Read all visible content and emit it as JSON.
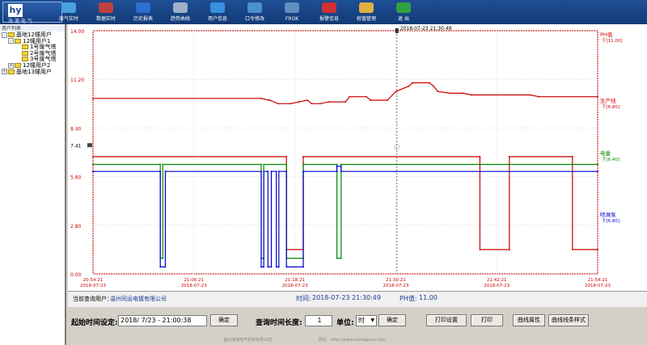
{
  "app": {
    "logo_text": "hy",
    "logo_subtitle": "海 港 电 气"
  },
  "toolbar": [
    {
      "label": "废气实时",
      "icon": "gauge-icon",
      "color": "#4aa0e0"
    },
    {
      "label": "数据实时",
      "icon": "monitor-icon",
      "color": "#c04040"
    },
    {
      "label": "历史报表",
      "icon": "chart-icon",
      "color": "#2b6fd0"
    },
    {
      "label": "趋势曲线",
      "icon": "curve-icon",
      "color": "#9db0c8"
    },
    {
      "label": "用户信息",
      "icon": "globe-icon",
      "color": "#3a8fe0"
    },
    {
      "label": "口令修改",
      "icon": "lock-icon",
      "color": "#4a90d0"
    },
    {
      "label": "FROK",
      "icon": "network-icon",
      "color": "#6090c0"
    },
    {
      "label": "报警信息",
      "icon": "alarm-icon",
      "color": "#d03030"
    },
    {
      "label": "权值管理",
      "icon": "key-icon",
      "color": "#e0b040"
    },
    {
      "label": "退  出",
      "icon": "exit-icon",
      "color": "#30a040"
    }
  ],
  "sidebar": {
    "title": "用户列表",
    "tree": [
      {
        "label": "基地12幢用户",
        "level": 0,
        "toggle": "-",
        "folder": true
      },
      {
        "label": "12幢用户1",
        "level": 1,
        "toggle": "-",
        "folder": true
      },
      {
        "label": "1号废气塔",
        "level": 2,
        "toggle": "",
        "folder": true
      },
      {
        "label": "2号废气塔",
        "level": 2,
        "toggle": "",
        "folder": true
      },
      {
        "label": "3号废气塔",
        "level": 2,
        "toggle": "",
        "folder": true
      },
      {
        "label": "12幢用户2",
        "level": 1,
        "toggle": "+",
        "folder": true
      },
      {
        "label": "基地13幢用户",
        "level": 0,
        "toggle": "+",
        "folder": true
      }
    ]
  },
  "chart_data": {
    "type": "line",
    "ylim": [
      0,
      14
    ],
    "y_ticks": [
      "0.00",
      "2.80",
      "5.60",
      "8.40",
      "11.20",
      "14.00"
    ],
    "y_tick_values": [
      0,
      2.8,
      5.6,
      8.4,
      11.2,
      14
    ],
    "extra_ytick": {
      "label": "7.41",
      "value": 7.41
    },
    "x_ticks": [
      {
        "time": "20:54:21",
        "date": "2018-07-23"
      },
      {
        "time": "21:06:21",
        "date": "2018-07-23"
      },
      {
        "time": "21:18:21",
        "date": "2018-07-23"
      },
      {
        "time": "21:30:21",
        "date": "2018-07-23"
      },
      {
        "time": "21:42:21",
        "date": "2018-07-23"
      },
      {
        "time": "21:54:21",
        "date": "2018-07-23"
      }
    ],
    "xlim_minutes": [
      0,
      60
    ],
    "cursor": {
      "minute": 36.13,
      "label": "2018-07-23  21:30:49"
    },
    "series": [
      {
        "name": "PH值",
        "color": "#cc0000",
        "values_text": "下[11.00]",
        "points": [
          [
            0,
            10.1
          ],
          [
            20,
            10.1
          ],
          [
            21,
            10
          ],
          [
            22,
            9.8
          ],
          [
            23.5,
            9.8
          ],
          [
            24.5,
            9.9
          ],
          [
            25.5,
            10
          ],
          [
            26,
            9.8
          ],
          [
            27,
            9.8
          ],
          [
            28,
            9.9
          ],
          [
            30,
            9.9
          ],
          [
            30.5,
            10.2
          ],
          [
            32.5,
            10.2
          ],
          [
            33,
            10
          ],
          [
            35,
            10
          ],
          [
            36,
            10.5
          ],
          [
            37.5,
            10.8
          ],
          [
            38,
            11
          ],
          [
            40,
            11
          ],
          [
            40.5,
            10.8
          ],
          [
            41,
            10.5
          ],
          [
            42.5,
            10.4
          ],
          [
            44,
            10.4
          ],
          [
            45,
            10.3
          ],
          [
            52,
            10.3
          ],
          [
            53,
            10.2
          ],
          [
            60,
            10.2
          ]
        ]
      },
      {
        "name": "生产线",
        "color": "#cc0000",
        "values_text": "下[6.80]",
        "points": [
          [
            0,
            6.75
          ],
          [
            23,
            6.75
          ],
          [
            23,
            1.4
          ],
          [
            25,
            1.4
          ],
          [
            25,
            6.75
          ],
          [
            46,
            6.75
          ],
          [
            46,
            1.4
          ],
          [
            49.5,
            1.4
          ],
          [
            49.5,
            6.75
          ],
          [
            57,
            6.75
          ],
          [
            57,
            1.4
          ],
          [
            60,
            1.4
          ]
        ]
      },
      {
        "name": "电量",
        "color": "#008800",
        "values_text": "下[6.40]",
        "points": [
          [
            0,
            6.3
          ],
          [
            8,
            6.3
          ],
          [
            8,
            0.9
          ],
          [
            8.3,
            0.9
          ],
          [
            8.3,
            6.3
          ],
          [
            20,
            6.3
          ],
          [
            20,
            0.9
          ],
          [
            20.3,
            0.9
          ],
          [
            20.3,
            6.3
          ],
          [
            23,
            6.3
          ],
          [
            23,
            0.9
          ],
          [
            25,
            0.9
          ],
          [
            25,
            6.3
          ],
          [
            29,
            6.3
          ],
          [
            29,
            0.9
          ],
          [
            29.5,
            0.9
          ],
          [
            29.5,
            6.3
          ],
          [
            60,
            6.3
          ]
        ]
      },
      {
        "name": "喷淋泵",
        "color": "#0000cc",
        "values_text": "下[6.80]",
        "points": [
          [
            0,
            5.9
          ],
          [
            8,
            5.9
          ],
          [
            8,
            0.4
          ],
          [
            8.6,
            0.4
          ],
          [
            8.6,
            5.9
          ],
          [
            20,
            5.9
          ],
          [
            20,
            0.4
          ],
          [
            20.3,
            0.4
          ],
          [
            20.3,
            5.9
          ],
          [
            20.8,
            5.9
          ],
          [
            20.8,
            0.4
          ],
          [
            21.2,
            0.4
          ],
          [
            21.2,
            5.9
          ],
          [
            21.8,
            5.9
          ],
          [
            21.8,
            0.4
          ],
          [
            22.1,
            0.4
          ],
          [
            22.1,
            5.9
          ],
          [
            23,
            5.9
          ],
          [
            23,
            0.4
          ],
          [
            25,
            0.4
          ],
          [
            25,
            5.9
          ],
          [
            29,
            5.9
          ],
          [
            29,
            6.2
          ],
          [
            29.5,
            6.2
          ],
          [
            29.5,
            5.9
          ],
          [
            60,
            5.9
          ]
        ]
      }
    ]
  },
  "infobar": {
    "query_user_label": "当前查询用户：",
    "query_user_value": "温州同运电镀有限公司",
    "time_label": "时间:",
    "time_value": "2018-07-23 21:30:49",
    "ph_label": "PH值:",
    "ph_value": "11.00"
  },
  "controls": {
    "start_time_label": "起始时间设定:",
    "start_time_value": "2018/ 7/23 - 21:00:38",
    "confirm1": "确定",
    "duration_label": "查询时间长度:",
    "duration_value": "1",
    "unit_label": "单位:",
    "unit_value": "时",
    "confirm2": "确定",
    "print_setup": "打印设置",
    "print": "打印",
    "curve_props": "曲线属性",
    "curve_style": "曲线线条样式"
  },
  "footer": {
    "company": "温州海港电气科技有限公司",
    "website": "网址：http://www.wzhaigang.com"
  },
  "colors": {
    "axis_red": "#cc0000",
    "text_blue": "#1a3c9a"
  }
}
